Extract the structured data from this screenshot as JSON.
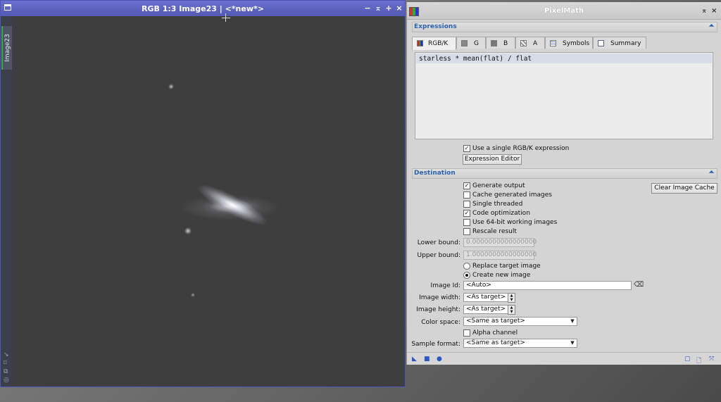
{
  "image_window": {
    "title": "RGB 1:3 Image23 | <*new*>",
    "side_tab_label": "Image23",
    "buttons": {
      "minimize": "−",
      "shade": "⌅",
      "maximize": "+",
      "close": "×"
    }
  },
  "pixelmath": {
    "title": "PixelMath",
    "expressions_section": "Expressions",
    "tabs": [
      {
        "label": "RGB/K",
        "icon": "rgb-channel-icon"
      },
      {
        "label": "G",
        "icon": "gray-channel-icon"
      },
      {
        "label": "B",
        "icon": "gray-channel-icon"
      },
      {
        "label": "A",
        "icon": "alpha-channel-icon"
      },
      {
        "label": "Symbols",
        "icon": "table-icon"
      },
      {
        "label": "Summary",
        "icon": "document-icon"
      }
    ],
    "expression": "starless * mean(flat) / flat",
    "use_single_expression": {
      "label": "Use a single RGB/K expression",
      "checked": true
    },
    "expression_editor_button": "Expression Editor",
    "destination_section": "Destination",
    "clear_cache_button": "Clear Image Cache",
    "options": [
      {
        "label": "Generate output",
        "checked": true
      },
      {
        "label": "Cache generated images",
        "checked": false
      },
      {
        "label": "Single threaded",
        "checked": false
      },
      {
        "label": "Code optimization",
        "checked": true
      },
      {
        "label": "Use 64-bit working images",
        "checked": false
      },
      {
        "label": "Rescale result",
        "checked": false
      }
    ],
    "lower_bound": {
      "label": "Lower bound:",
      "value": "0.0000000000000000"
    },
    "upper_bound": {
      "label": "Upper bound:",
      "value": "1.0000000000000000"
    },
    "replace_target": {
      "label": "Replace target image",
      "selected": false
    },
    "create_new": {
      "label": "Create new image",
      "selected": true
    },
    "image_id": {
      "label": "Image Id:",
      "value": "<Auto>"
    },
    "image_width": {
      "label": "Image width:",
      "value": "<As target>"
    },
    "image_height": {
      "label": "Image height:",
      "value": "<As target>"
    },
    "color_space": {
      "label": "Color space:",
      "value": "<Same as target>"
    },
    "alpha_channel": {
      "label": "Alpha channel",
      "checked": false
    },
    "sample_format": {
      "label": "Sample format:",
      "value": "<Same as target>"
    }
  }
}
